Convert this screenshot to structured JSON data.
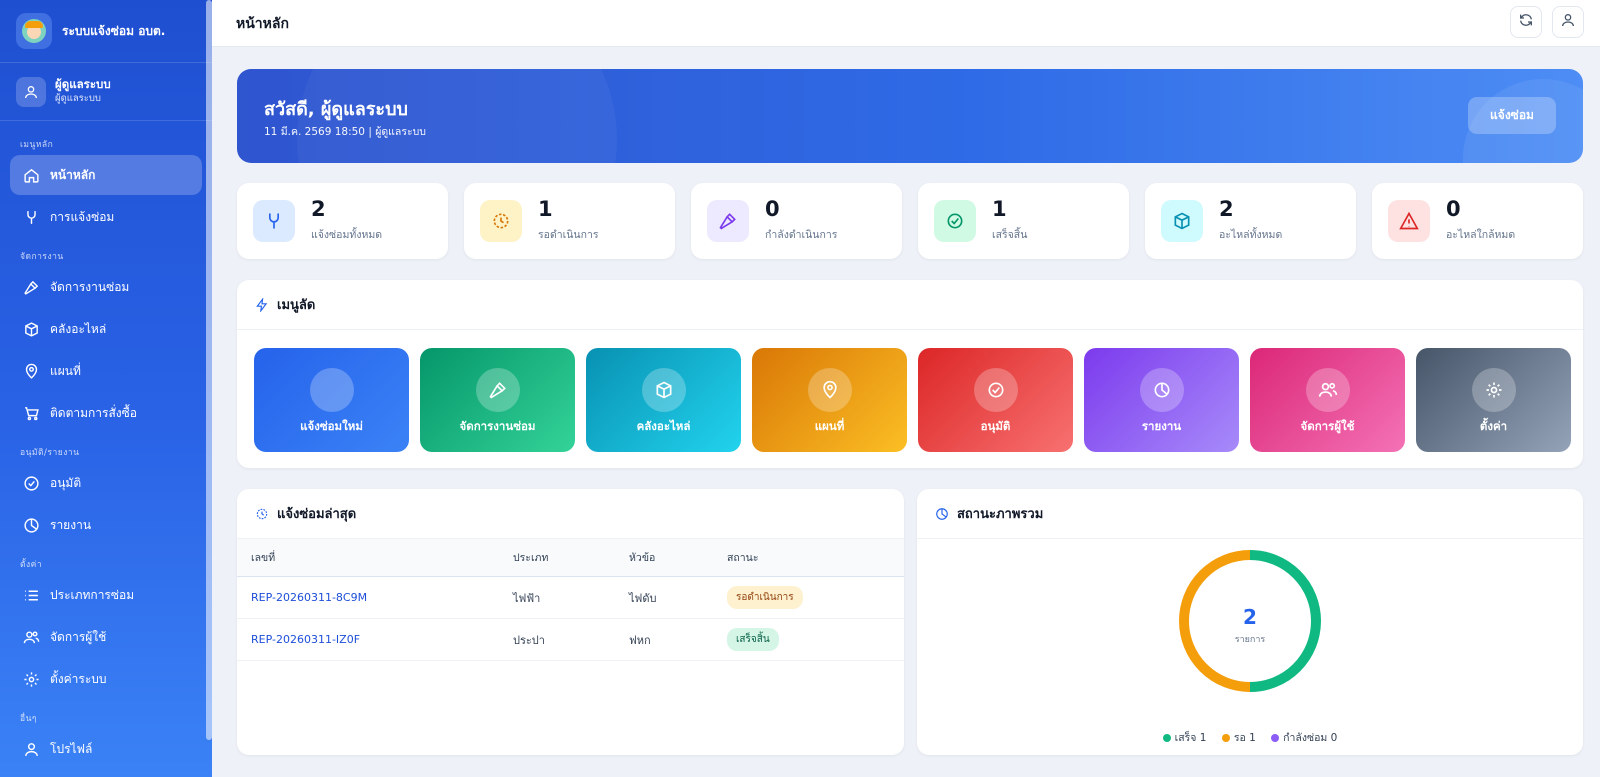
{
  "app": {
    "title": "ระบบแจ้งซ่อม อบต."
  },
  "user": {
    "name": "ผู้ดูแลระบบ",
    "role": "ผู้ดูแลระบบ"
  },
  "sidebar": {
    "sections": [
      "เมนูหลัก",
      "จัดการงาน",
      "อนุมัติ/รายงาน",
      "ตั้งค่า",
      "อื่นๆ"
    ],
    "items": [
      {
        "label": "หน้าหลัก",
        "icon": "home-icon",
        "active": true
      },
      {
        "label": "การแจ้งซ่อม",
        "icon": "wrench-icon"
      },
      {
        "label": "จัดการงานซ่อม",
        "icon": "hammer-icon"
      },
      {
        "label": "คลังอะไหล่",
        "icon": "box-icon"
      },
      {
        "label": "แผนที่",
        "icon": "map-pin-icon"
      },
      {
        "label": "ติดตามการสั่งซื้อ",
        "icon": "cart-icon"
      },
      {
        "label": "อนุมัติ",
        "icon": "check-circle-icon"
      },
      {
        "label": "รายงาน",
        "icon": "pie-chart-icon"
      },
      {
        "label": "ประเภทการซ่อม",
        "icon": "list-icon"
      },
      {
        "label": "จัดการผู้ใช้",
        "icon": "users-icon"
      },
      {
        "label": "ตั้งค่าระบบ",
        "icon": "gear-icon"
      },
      {
        "label": "โปรไฟล์",
        "icon": "user-icon"
      }
    ]
  },
  "header": {
    "page_title": "หน้าหลัก"
  },
  "hero": {
    "greeting": "สวัสดี, ผู้ดูแลระบบ",
    "subtitle": "11 มี.ค. 2569 18:50 | ผู้ดูแลระบบ",
    "button": "แจ้งซ่อม"
  },
  "stats": [
    {
      "value": "2",
      "label": "แจ้งซ่อมทั้งหมด",
      "icon": "wrench-icon",
      "bg": "#dbeafe",
      "fg": "#2563eb"
    },
    {
      "value": "1",
      "label": "รอดำเนินการ",
      "icon": "clock-icon",
      "bg": "#fef3c7",
      "fg": "#d97706"
    },
    {
      "value": "0",
      "label": "กำลังดำเนินการ",
      "icon": "hammer-icon",
      "bg": "#ede9fe",
      "fg": "#7c3aed"
    },
    {
      "value": "1",
      "label": "เสร็จสิ้น",
      "icon": "check-circle-icon",
      "bg": "#d1fae5",
      "fg": "#059669"
    },
    {
      "value": "2",
      "label": "อะไหล่ทั้งหมด",
      "icon": "box-icon",
      "bg": "#cffafe",
      "fg": "#0891b2"
    },
    {
      "value": "0",
      "label": "อะไหล่ใกล้หมด",
      "icon": "warning-icon",
      "bg": "#fee2e2",
      "fg": "#dc2626"
    }
  ],
  "quick_menu": {
    "title": "เมนูลัด",
    "tiles": [
      {
        "label": "แจ้งซ่อมใหม่",
        "icon": "plus-icon",
        "from": "#2563eb",
        "to": "#3b82f6"
      },
      {
        "label": "จัดการงานซ่อม",
        "icon": "hammer-icon",
        "from": "#059669",
        "to": "#34d399"
      },
      {
        "label": "คลังอะไหล่",
        "icon": "box-icon",
        "from": "#0891b2",
        "to": "#22d3ee"
      },
      {
        "label": "แผนที่",
        "icon": "map-pin-icon",
        "from": "#d97706",
        "to": "#fbbf24"
      },
      {
        "label": "อนุมัติ",
        "icon": "check-circle-icon",
        "from": "#dc2626",
        "to": "#f87171"
      },
      {
        "label": "รายงาน",
        "icon": "pie-chart-icon",
        "from": "#7c3aed",
        "to": "#a78bfa"
      },
      {
        "label": "จัดการผู้ใช้",
        "icon": "users-icon",
        "from": "#db2777",
        "to": "#f472b6"
      },
      {
        "label": "ตั้งค่า",
        "icon": "gear-icon",
        "from": "#475569",
        "to": "#94a3b8"
      }
    ]
  },
  "recent": {
    "title": "แจ้งซ่อมล่าสุด",
    "columns": [
      "เลขที่",
      "ประเภท",
      "หัวข้อ",
      "สถานะ"
    ],
    "rows": [
      {
        "id": "REP-20260311-8C9M",
        "type": "ไฟฟ้า",
        "topic": "ไฟดับ",
        "status": "รอดำเนินการ",
        "status_kind": "wait"
      },
      {
        "id": "REP-20260311-IZ0F",
        "type": "ประปา",
        "topic": "ฟหก",
        "status": "เสร็จสิ้น",
        "status_kind": "done"
      }
    ]
  },
  "overview": {
    "title": "สถานะภาพรวม",
    "total": "2",
    "total_label": "รายการ",
    "legend": [
      {
        "label": "เสร็จ 1",
        "color": "#10b981"
      },
      {
        "label": "รอ 1",
        "color": "#f59e0b"
      },
      {
        "label": "กำลังซ่อม 0",
        "color": "#8b5cf6"
      }
    ]
  },
  "chart_data": {
    "type": "pie",
    "categories": [
      "เสร็จ",
      "รอ",
      "กำลังซ่อม"
    ],
    "values": [
      1,
      1,
      0
    ],
    "colors": [
      "#10b981",
      "#f59e0b",
      "#8b5cf6"
    ]
  }
}
